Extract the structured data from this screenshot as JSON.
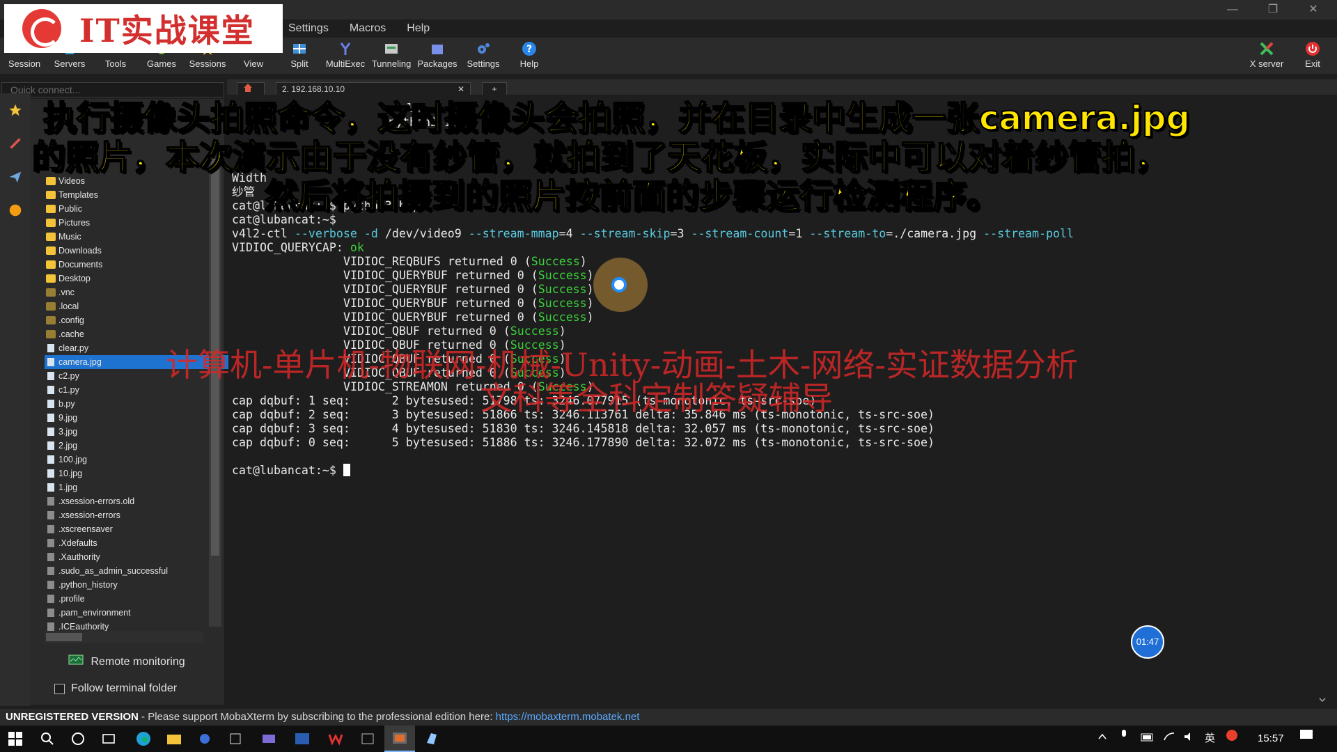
{
  "window": {
    "minimize": "—",
    "maximize": "❐",
    "close": "✕"
  },
  "logo": {
    "text": "IT实战课堂"
  },
  "menu": [
    "Settings",
    "Macros",
    "Help"
  ],
  "toolbar": {
    "buttons": [
      "Session",
      "Servers",
      "Tools",
      "Games",
      "Sessions",
      "View",
      "Split",
      "MultiExec",
      "Tunneling",
      "Packages",
      "Settings",
      "Help"
    ],
    "right_buttons": [
      "X server",
      "Exit"
    ]
  },
  "quick_connect": {
    "placeholder": "Quick connect..."
  },
  "tabs": {
    "session_tab": "2. 192.168.10.10",
    "close": "✕",
    "add": "+"
  },
  "file_tree": [
    {
      "name": "Videos",
      "kind": "folder"
    },
    {
      "name": "Templates",
      "kind": "folder"
    },
    {
      "name": "Public",
      "kind": "folder"
    },
    {
      "name": "Pictures",
      "kind": "folder"
    },
    {
      "name": "Music",
      "kind": "folder"
    },
    {
      "name": "Downloads",
      "kind": "folder"
    },
    {
      "name": "Documents",
      "kind": "folder"
    },
    {
      "name": "Desktop",
      "kind": "folder"
    },
    {
      "name": ".vnc",
      "kind": "hidden-folder"
    },
    {
      "name": ".local",
      "kind": "hidden-folder"
    },
    {
      "name": ".config",
      "kind": "hidden-folder"
    },
    {
      "name": ".cache",
      "kind": "hidden-folder"
    },
    {
      "name": "clear.py",
      "kind": "file"
    },
    {
      "name": "camera.jpg",
      "kind": "file",
      "selected": true
    },
    {
      "name": "c2.py",
      "kind": "file"
    },
    {
      "name": "c1.py",
      "kind": "file"
    },
    {
      "name": "b.py",
      "kind": "file"
    },
    {
      "name": "9.jpg",
      "kind": "file"
    },
    {
      "name": "3.jpg",
      "kind": "file"
    },
    {
      "name": "2.jpg",
      "kind": "file"
    },
    {
      "name": "100.jpg",
      "kind": "file"
    },
    {
      "name": "10.jpg",
      "kind": "file"
    },
    {
      "name": "1.jpg",
      "kind": "file"
    },
    {
      "name": ".xsession-errors.old",
      "kind": "hidden-file"
    },
    {
      "name": ".xsession-errors",
      "kind": "hidden-file"
    },
    {
      "name": ".xscreensaver",
      "kind": "hidden-file"
    },
    {
      "name": ".Xdefaults",
      "kind": "hidden-file"
    },
    {
      "name": ".Xauthority",
      "kind": "hidden-file"
    },
    {
      "name": ".sudo_as_admin_successful",
      "kind": "hidden-file"
    },
    {
      "name": ".python_history",
      "kind": "hidden-file"
    },
    {
      "name": ".profile",
      "kind": "hidden-file"
    },
    {
      "name": ".pam_environment",
      "kind": "hidden-file"
    },
    {
      "name": ".ICEauthority",
      "kind": "hidden-file"
    }
  ],
  "sidebar_footer": {
    "remote_monitoring": "Remote monitoring",
    "follow_terminal_folder": "Follow terminal folder"
  },
  "terminal": {
    "partial_lines": [
      "clea",
      "python3 1.py",
      "Width",
      "纱管",
      "cat@lubancat:~$ python3 b.py"
    ],
    "prompt": "cat@lubancat:~$",
    "command": {
      "cmd": "v4l2-ctl",
      "args": [
        {
          "opt": "--verbose",
          "val": ""
        },
        {
          "opt": "-d",
          "val": " /dev/video9"
        },
        {
          "opt": "--stream-mmap",
          "val": "=4"
        },
        {
          "opt": "--stream-skip",
          "val": "=3"
        },
        {
          "opt": "--stream-count",
          "val": "=1"
        },
        {
          "opt": "--stream-to",
          "val": "=./camera.jpg"
        },
        {
          "opt": "--stream-poll",
          "val": ""
        }
      ]
    },
    "querycap": {
      "label": "VIDIOC_QUERYCAP:",
      "status": "ok"
    },
    "ioctl_lines": [
      {
        "name": "VIDIOC_REQBUFS returned 0 (",
        "status": "Success",
        "tail": ")"
      },
      {
        "name": "VIDIOC_QUERYBUF returned 0 (",
        "status": "Success",
        "tail": ")"
      },
      {
        "name": "VIDIOC_QUERYBUF returned 0 (",
        "status": "Success",
        "tail": ")"
      },
      {
        "name": "VIDIOC_QUERYBUF returned 0 (",
        "status": "Success",
        "tail": ")"
      },
      {
        "name": "VIDIOC_QUERYBUF returned 0 (",
        "status": "Success",
        "tail": ")"
      },
      {
        "name": "VIDIOC_QBUF returned 0 (",
        "status": "Success",
        "tail": ")"
      },
      {
        "name": "VIDIOC_QBUF returned 0 (",
        "status": "Success",
        "tail": ")"
      },
      {
        "name": "VIDIOC_QBUF returned 0 (",
        "status": "Success",
        "tail": ")"
      },
      {
        "name": "VIDIOC_QBUF returned 0 (",
        "status": "Success",
        "tail": ")"
      },
      {
        "name": "VIDIOC_STREAMON returned 0 (",
        "status": "Success",
        "tail": ")"
      }
    ],
    "cap_lines": [
      "cap dqbuf: 1 seq:      2 bytesused: 51798 ts: 3246.077915 (ts-monotonic, ts-src-soe)",
      "cap dqbuf: 2 seq:      3 bytesused: 51866 ts: 3246.113761 delta: 35.846 ms (ts-monotonic, ts-src-soe)",
      "cap dqbuf: 3 seq:      4 bytesused: 51830 ts: 3246.145818 delta: 32.057 ms (ts-monotonic, ts-src-soe)",
      "cap dqbuf: 0 seq:      5 bytesused: 51886 ts: 3246.177890 delta: 32.072 ms (ts-monotonic, ts-src-soe)"
    ]
  },
  "overlay": {
    "caption": [
      "执行摄像头拍照命令，这时摄像头会拍照，并在目录中生成一张camera.jpg",
      "的照片，本次演示由于没有纱管，就拍到了天花板，实际中可以对着纱管拍，",
      "然后将拍摄到的照片按前面的步骤运行检测程序。"
    ],
    "watermark": [
      "计算机-单片机-物联网-机械-Unity-动画-土木-网络-实证数据分析",
      "文科等全科定制答疑辅导"
    ],
    "timer": "01:47"
  },
  "statusbar": {
    "unregistered": "UNREGISTERED VERSION",
    "message": "  -  Please support MobaXterm by subscribing to the professional edition here:  ",
    "link": "https://mobaxterm.mobatek.net"
  },
  "taskbar": {
    "clock": "15:57",
    "ime": "英"
  },
  "colors": {
    "accent": "#1e73d0",
    "term_cyan": "#59c9dd",
    "term_green": "#3bd23b",
    "caption_yellow": "#ffe600",
    "watermark_red": "#d62828"
  }
}
